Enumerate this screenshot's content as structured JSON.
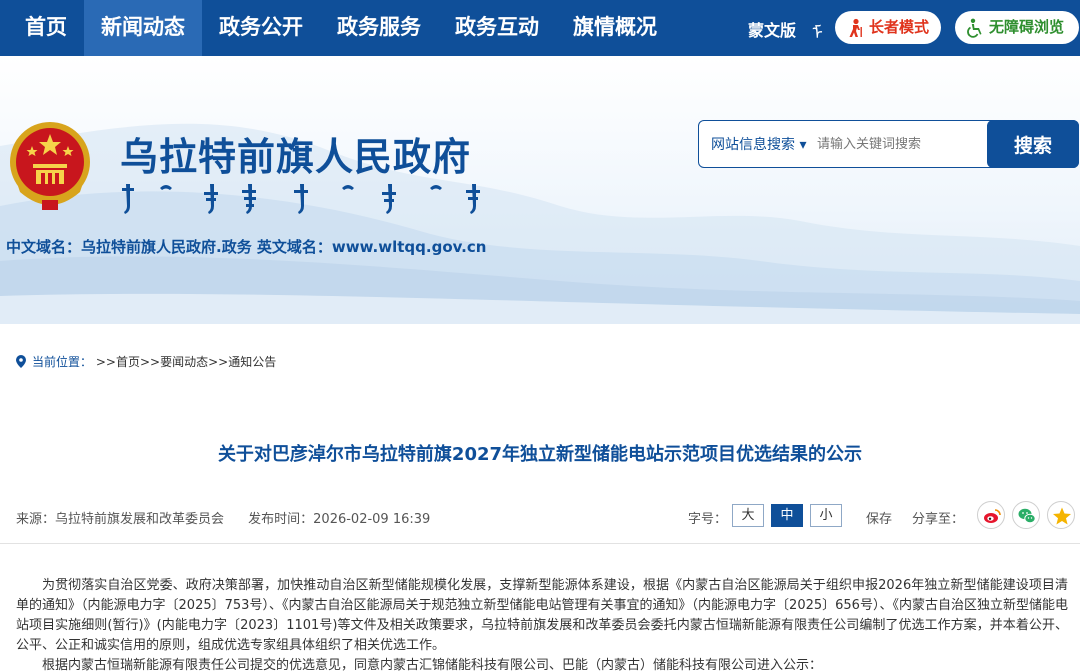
{
  "nav": {
    "items": [
      "首页",
      "新闻动态",
      "政务公开",
      "政务服务",
      "政务互动",
      "旗情概况"
    ],
    "active_index": 1,
    "mongolian_version": "蒙文版",
    "mongolian_glyph": "ᠮ",
    "elder_mode": "长者模式",
    "accessible": "无障碍浏览"
  },
  "header": {
    "title": "乌拉特前旗人民政府",
    "domain_text": "中文域名：乌拉特前旗人民政府.政务   英文域名：www.wltqq.gov.cn"
  },
  "search": {
    "type_label": "网站信息搜索 ▾",
    "placeholder": "请输入关键词搜索",
    "button_label": "搜索"
  },
  "breadcrumb": {
    "current_label": "当前位置：",
    "path": [
      ">>首页",
      ">>要闻动态",
      ">>通知公告"
    ]
  },
  "article": {
    "title": "关于对巴彦淖尔市乌拉特前旗2027年独立新型储能电站示范项目优选结果的公示",
    "source": "来源：乌拉特前旗发展和改革委员会",
    "published": "发布时间：2026-02-09 16:39",
    "font_size_label": "字号：",
    "font_sizes": [
      "大",
      "中",
      "小"
    ],
    "font_size_active": "中",
    "save_label": "保存",
    "share_label": "分享至：",
    "paragraphs": [
      "为贯彻落实自治区党委、政府决策部署，加快推动自治区新型储能规模化发展，支撑新型能源体系建设，根据《内蒙古自治区能源局关于组织申报2026年独立新型储能建设项目清单的通知》（内能源电力字〔2025〕753号）、《内蒙古自治区能源局关于规范独立新型储能电站管理有关事宜的通知》（内能源电力字〔2025〕656号）、《内蒙古自治区独立新型储能电站项目实施细则(暂行)》(内能电力字〔2023〕1101号)等文件及相关政策要求，乌拉特前旗发展和改革委员会委托内蒙古恒瑞新能源有限责任公司编制了优选工作方案，并本着公开、公平、公正和诚实信用的原则，组成优选专家组具体组织了相关优选工作。",
      "根据内蒙古恒瑞新能源有限责任公司提交的优选意见，同意内蒙古汇锦储能科技有限公司、巴能（内蒙古）储能科技有限公司进入公示："
    ]
  },
  "colors": {
    "nav_bg": "#0f4f99",
    "nav_active": "#2a6ab5",
    "brand_blue": "#0f4f99",
    "elder_red": "#e0331c",
    "access_green": "#2f8f2f"
  }
}
